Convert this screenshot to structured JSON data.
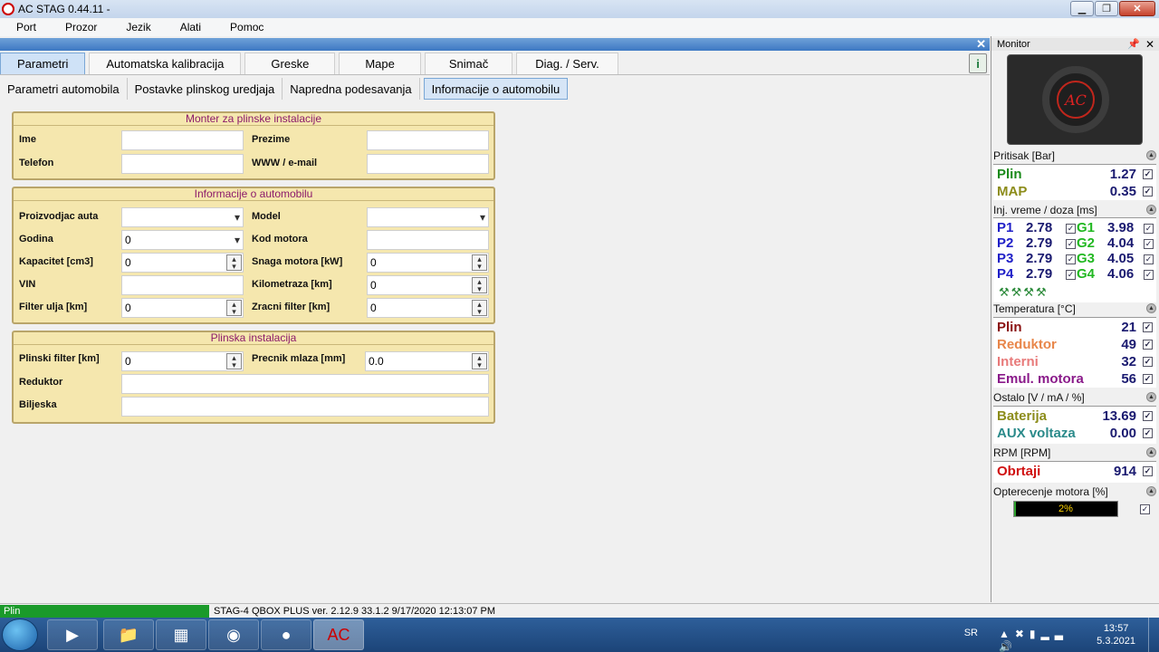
{
  "window": {
    "title": "AC STAG 0.44.11 -"
  },
  "menu": [
    "Port",
    "Prozor",
    "Jezik",
    "Alati",
    "Pomoc"
  ],
  "main_tabs": [
    "Parametri",
    "Automatska kalibracija",
    "Greske",
    "Mape",
    "Snimač",
    "Diag. / Serv."
  ],
  "sub_tabs": [
    "Parametri automobila",
    "Postavke plinskog uredjaja",
    "Napredna podesavanja",
    "Informacije o automobilu"
  ],
  "panel1": {
    "title": "Monter za plinske instalacije",
    "ime": "Ime",
    "prezime": "Prezime",
    "telefon": "Telefon",
    "www": "WWW / e-mail"
  },
  "panel2": {
    "title": "Informacije o automobilu",
    "proizvodjac": "Proizvodjac auta",
    "model": "Model",
    "godina": "Godina",
    "godina_val": "0",
    "kod_motora": "Kod motora",
    "kapacitet": "Kapacitet [cm3]",
    "kapacitet_val": "0",
    "snaga": "Snaga motora [kW]",
    "snaga_val": "0",
    "vin": "VIN",
    "kilometraza": "Kilometraza [km]",
    "kilometraza_val": "0",
    "filter_ulja": "Filter ulja [km]",
    "filter_ulja_val": "0",
    "zracni": "Zracni filter [km]",
    "zracni_val": "0"
  },
  "panel3": {
    "title": "Plinska instalacija",
    "plinski_filter": "Plinski filter [km]",
    "plinski_filter_val": "0",
    "precnik": "Precnik mlaza [mm]",
    "precnik_val": "0.0",
    "reduktor": "Reduktor",
    "biljeska": "Biljeska"
  },
  "monitor": {
    "title": "Monitor",
    "pritisak": {
      "title": "Pritisak [Bar]",
      "plin_label": "Plin",
      "plin": "1.27",
      "map_label": "MAP",
      "map": "0.35"
    },
    "inj": {
      "title": "Inj. vreme / doza [ms]",
      "p": [
        {
          "l": "P1",
          "v": "2.78"
        },
        {
          "l": "P2",
          "v": "2.79"
        },
        {
          "l": "P3",
          "v": "2.79"
        },
        {
          "l": "P4",
          "v": "2.79"
        }
      ],
      "g": [
        {
          "l": "G1",
          "v": "3.98"
        },
        {
          "l": "G2",
          "v": "4.04"
        },
        {
          "l": "G3",
          "v": "4.05"
        },
        {
          "l": "G4",
          "v": "4.06"
        }
      ]
    },
    "temp": {
      "title": "Temperatura [°C]",
      "rows": [
        {
          "l": "Plin",
          "v": "21"
        },
        {
          "l": "Reduktor",
          "v": "49"
        },
        {
          "l": "Interni",
          "v": "32"
        },
        {
          "l": "Emul. motora",
          "v": "56"
        }
      ]
    },
    "ostalo": {
      "title": "Ostalo [V / mA / %]",
      "bat_label": "Baterija",
      "bat": "13.69",
      "aux_label": "AUX voltaza",
      "aux": "0.00"
    },
    "rpm": {
      "title": "RPM [RPM]",
      "label": "Obrtaji",
      "value": "914"
    },
    "load": {
      "title": "Opterecenje motora [%]",
      "text": "2%",
      "percent": 2
    }
  },
  "status": {
    "mode": "Plin",
    "info": "STAG-4 QBOX PLUS  ver. 2.12.9  33.1.2  9/17/2020 12:13:07 PM"
  },
  "taskbar": {
    "lang": "SR",
    "time": "13:57",
    "date": "5.3.2021"
  },
  "colors": {
    "plin_green": "#1a8a1a",
    "map_olive": "#8c8c1a",
    "p_blue": "#2020c8",
    "g_green": "#22b822",
    "temp_red": "#8a1010",
    "reduktor_orange": "#e8864a",
    "interni_pink": "#e87a7a",
    "emul_purple": "#8a1a8a",
    "bat_olive": "#8c8c1a",
    "aux_teal": "#2a8a8a",
    "obrtaji_red": "#d01010"
  }
}
